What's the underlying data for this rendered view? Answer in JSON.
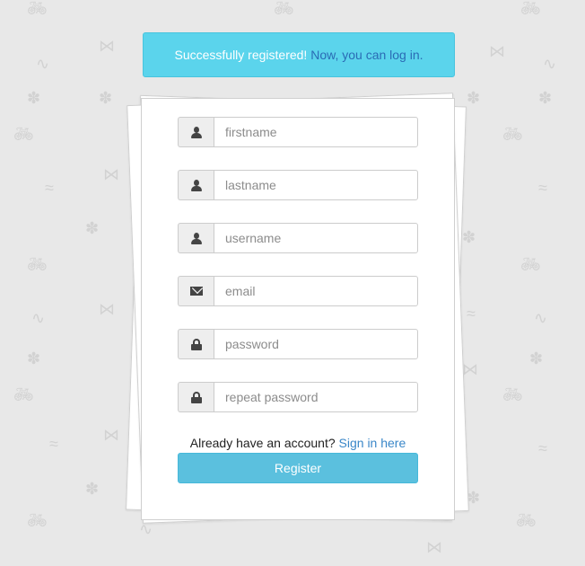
{
  "alert": {
    "message": "Successfully registered!",
    "link_text": "Now, you can log in.",
    "color": "#5bd4ec"
  },
  "form": {
    "fields": [
      {
        "placeholder": "firstname",
        "icon": "user-icon"
      },
      {
        "placeholder": "lastname",
        "icon": "user-icon"
      },
      {
        "placeholder": "username",
        "icon": "user-icon"
      },
      {
        "placeholder": "email",
        "icon": "envelope-icon"
      },
      {
        "placeholder": "password",
        "icon": "lock-icon"
      },
      {
        "placeholder": "repeat password",
        "icon": "lock-icon"
      }
    ],
    "signin_prompt": "Already have an account?",
    "signin_link": "Sign in here",
    "register_label": "Register",
    "accent": "#5bc0de"
  }
}
